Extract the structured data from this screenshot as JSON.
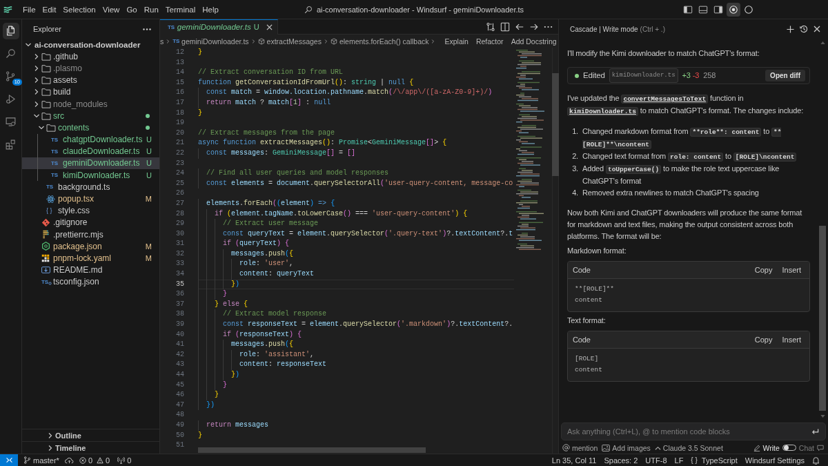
{
  "title_bar": {
    "menu": [
      "File",
      "Edit",
      "Selection",
      "View",
      "Go",
      "Run",
      "Terminal",
      "Help"
    ],
    "title": "ai-conversation-downloader - Windsurf - geminiDownloader.ts",
    "toggles": [
      {
        "kind": "sidebar",
        "selected": false
      },
      {
        "kind": "panel",
        "selected": false
      },
      {
        "kind": "auxiliary",
        "selected": false
      },
      {
        "kind": "cascade",
        "selected": true
      },
      {
        "kind": "account",
        "selected": false
      }
    ]
  },
  "activity_bar": [
    {
      "kind": "explorer",
      "selected": true
    },
    {
      "kind": "search",
      "selected": false
    },
    {
      "kind": "scm",
      "selected": false,
      "badge": "10"
    },
    {
      "kind": "debug",
      "selected": false
    },
    {
      "kind": "remote",
      "selected": false
    },
    {
      "kind": "extensions",
      "selected": false
    }
  ],
  "sidebar": {
    "title": "Explorer",
    "tree": [
      {
        "kind": "root",
        "label": "ai-conversation-downloader",
        "expanded": true,
        "selected": false,
        "children": [
          {
            "kind": "folder",
            "label": ".github",
            "expanded": false,
            "selected": false,
            "dot": false
          },
          {
            "kind": "folder",
            "label": ".plasmo",
            "expanded": false,
            "selected": false,
            "dot": false,
            "color": "#8c8c8c"
          },
          {
            "kind": "folder",
            "label": "assets",
            "expanded": false,
            "selected": false,
            "dot": false
          },
          {
            "kind": "folder",
            "label": "build",
            "expanded": false,
            "selected": false,
            "dot": false
          },
          {
            "kind": "folder",
            "label": "node_modules",
            "expanded": false,
            "selected": false,
            "dot": false,
            "color": "#8c8c8c"
          },
          {
            "kind": "folder",
            "label": "src",
            "expanded": true,
            "selected": false,
            "dot": true,
            "color": "#73c991",
            "children": [
              {
                "kind": "folder",
                "label": "contents",
                "expanded": true,
                "selected": false,
                "dot": true,
                "color": "#73c991",
                "children": [
                  {
                    "kind": "ts",
                    "icon_label": "TS",
                    "label": "chatgptDownloader.ts",
                    "selected": false,
                    "color": "#73c991",
                    "badge": "U"
                  },
                  {
                    "kind": "ts",
                    "icon_label": "TS",
                    "label": "claudeDownloader.ts",
                    "selected": false,
                    "color": "#73c991",
                    "badge": "U"
                  },
                  {
                    "kind": "ts",
                    "icon_label": "TS",
                    "label": "geminiDownloader.ts",
                    "selected": true,
                    "color": "#73c991",
                    "badge": "U"
                  },
                  {
                    "kind": "ts",
                    "icon_label": "TS",
                    "label": "kimiDownloader.ts",
                    "selected": false,
                    "color": "#73c991",
                    "badge": "U"
                  }
                ]
              },
              {
                "kind": "ts",
                "icon_label": "TS",
                "label": "background.ts",
                "selected": false
              },
              {
                "kind": "react",
                "label": "popup.tsx",
                "selected": false,
                "color": "#e2c08d",
                "badge": "M"
              },
              {
                "kind": "css",
                "icon_label": "{ }",
                "label": "style.css",
                "selected": false
              }
            ]
          },
          {
            "kind": "git",
            "label": ".gitignore",
            "selected": false
          },
          {
            "kind": "prettier",
            "label": ".prettierrc.mjs",
            "selected": false
          },
          {
            "kind": "npm",
            "label": "package.json",
            "selected": false,
            "color": "#e2c08d",
            "badge": "M"
          },
          {
            "kind": "pnpm",
            "label": "pnpm-lock.yaml",
            "selected": false,
            "color": "#e2c08d",
            "badge": "M"
          },
          {
            "kind": "markdown",
            "label": "README.md",
            "selected": false
          },
          {
            "kind": "tsconfig",
            "icon_label": "TS",
            "label": "tsconfig.json",
            "selected": false
          }
        ]
      }
    ],
    "sections": [
      {
        "label": "Outline",
        "expanded": false
      },
      {
        "label": "Timeline",
        "expanded": false
      }
    ]
  },
  "editor": {
    "tabs": [
      {
        "icon_label": "TS",
        "name": "geminiDownloader.ts",
        "badge": "U",
        "color": "#73c991",
        "preview": true,
        "selected": true
      }
    ],
    "breadcrumbs": [
      {
        "kind": "text",
        "label": "s"
      },
      {
        "kind": "file",
        "icon_label": "TS",
        "label": "geminiDownloader.ts"
      },
      {
        "kind": "symbol",
        "label": "extractMessages"
      },
      {
        "kind": "symbol",
        "label": "elements.forEach() callback"
      }
    ],
    "actions": [
      "Explain",
      "Refactor",
      "Add Docstring"
    ],
    "lines": [
      {
        "number": "12",
        "current": false,
        "tokens": [
          {
            "kind": "bracket1",
            "text": "}"
          }
        ]
      },
      {
        "number": "13",
        "current": false
      },
      {
        "number": "14",
        "current": false,
        "tokens": [
          {
            "kind": "comment",
            "text": "// Extract conversation ID from URL"
          }
        ]
      },
      {
        "number": "15",
        "current": false,
        "tokens": [
          {
            "kind": "keyword",
            "text": "function "
          },
          {
            "kind": "function",
            "text": "getConversationIdFromUrl"
          },
          {
            "kind": "bracket1",
            "text": "()"
          },
          {
            "kind": "plain",
            "text": ": "
          },
          {
            "kind": "type",
            "text": "string"
          },
          {
            "kind": "plain",
            "text": " | "
          },
          {
            "kind": "keyword",
            "text": "null "
          },
          {
            "kind": "bracket1",
            "text": "{"
          }
        ]
      },
      {
        "number": "16",
        "current": false,
        "tokens": [
          {
            "kind": "keyword",
            "text": "  const "
          },
          {
            "kind": "variable",
            "text": "match"
          },
          {
            "kind": "plain",
            "text": " = "
          },
          {
            "kind": "variable",
            "text": "window.location.pathname"
          },
          {
            "kind": "plain",
            "text": "."
          },
          {
            "kind": "function",
            "text": "match"
          },
          {
            "kind": "bracket2",
            "text": "("
          },
          {
            "kind": "regex",
            "text": "/\\/app\\/([a-zA-Z0-9]+)/"
          },
          {
            "kind": "bracket2",
            "text": ")"
          }
        ]
      },
      {
        "number": "17",
        "current": false,
        "tokens": [
          {
            "kind": "control",
            "text": "  return "
          },
          {
            "kind": "variable",
            "text": "match"
          },
          {
            "kind": "plain",
            "text": " ? "
          },
          {
            "kind": "variable",
            "text": "match"
          },
          {
            "kind": "bracket2",
            "text": "["
          },
          {
            "kind": "number",
            "text": "1"
          },
          {
            "kind": "bracket2",
            "text": "]"
          },
          {
            "kind": "plain",
            "text": " : "
          },
          {
            "kind": "keyword",
            "text": "null"
          }
        ]
      },
      {
        "number": "18",
        "current": false,
        "tokens": [
          {
            "kind": "bracket1",
            "text": "}"
          }
        ]
      },
      {
        "number": "19",
        "current": false
      },
      {
        "number": "20",
        "current": false,
        "tokens": [
          {
            "kind": "comment",
            "text": "// Extract messages from the page"
          }
        ]
      },
      {
        "number": "21",
        "current": false,
        "tokens": [
          {
            "kind": "keyword",
            "text": "async function "
          },
          {
            "kind": "function",
            "text": "extractMessages"
          },
          {
            "kind": "bracket1",
            "text": "()"
          },
          {
            "kind": "plain",
            "text": ": "
          },
          {
            "kind": "type",
            "text": "Promise"
          },
          {
            "kind": "plain",
            "text": "<"
          },
          {
            "kind": "type",
            "text": "GeminiMessage"
          },
          {
            "kind": "bracket2",
            "text": "[]"
          },
          {
            "kind": "plain",
            "text": "> "
          },
          {
            "kind": "bracket1",
            "text": "{"
          }
        ]
      },
      {
        "number": "22",
        "current": false,
        "tokens": [
          {
            "kind": "keyword",
            "text": "  const "
          },
          {
            "kind": "variable",
            "text": "messages"
          },
          {
            "kind": "plain",
            "text": ": "
          },
          {
            "kind": "type",
            "text": "GeminiMessage"
          },
          {
            "kind": "bracket2",
            "text": "[]"
          },
          {
            "kind": "plain",
            "text": " = "
          },
          {
            "kind": "bracket2",
            "text": "[]"
          }
        ]
      },
      {
        "number": "23",
        "current": false
      },
      {
        "number": "24",
        "current": false,
        "tokens": [
          {
            "kind": "comment",
            "text": "  // Find all user queries and model responses"
          }
        ]
      },
      {
        "number": "25",
        "current": false,
        "tokens": [
          {
            "kind": "keyword",
            "text": "  const "
          },
          {
            "kind": "variable",
            "text": "elements"
          },
          {
            "kind": "plain",
            "text": " = "
          },
          {
            "kind": "variable",
            "text": "document"
          },
          {
            "kind": "plain",
            "text": "."
          },
          {
            "kind": "function",
            "text": "querySelectorAll"
          },
          {
            "kind": "bracket2",
            "text": "("
          },
          {
            "kind": "string",
            "text": "'user-query-content, message-co"
          }
        ]
      },
      {
        "number": "26",
        "current": false
      },
      {
        "number": "27",
        "current": false,
        "tokens": [
          {
            "kind": "variable",
            "text": "  elements"
          },
          {
            "kind": "plain",
            "text": "."
          },
          {
            "kind": "function",
            "text": "forEach"
          },
          {
            "kind": "bracket2",
            "text": "("
          },
          {
            "kind": "bracket3",
            "text": "("
          },
          {
            "kind": "variable",
            "text": "element"
          },
          {
            "kind": "bracket3",
            "text": ")"
          },
          {
            "kind": "keyword",
            "text": " => "
          },
          {
            "kind": "bracket3",
            "text": "{"
          }
        ]
      },
      {
        "number": "28",
        "current": false,
        "tokens": [
          {
            "kind": "control",
            "text": "    if "
          },
          {
            "kind": "bracket1",
            "text": "("
          },
          {
            "kind": "variable",
            "text": "element.tagName"
          },
          {
            "kind": "plain",
            "text": "."
          },
          {
            "kind": "function",
            "text": "toLowerCase"
          },
          {
            "kind": "bracket2",
            "text": "()"
          },
          {
            "kind": "plain",
            "text": " === "
          },
          {
            "kind": "string",
            "text": "'user-query-content'"
          },
          {
            "kind": "bracket1",
            "text": ") {"
          }
        ]
      },
      {
        "number": "29",
        "current": false,
        "tokens": [
          {
            "kind": "comment",
            "text": "      // Extract user message"
          }
        ]
      },
      {
        "number": "30",
        "current": false,
        "tokens": [
          {
            "kind": "keyword",
            "text": "      const "
          },
          {
            "kind": "variable",
            "text": "queryText"
          },
          {
            "kind": "plain",
            "text": " = "
          },
          {
            "kind": "variable",
            "text": "element"
          },
          {
            "kind": "plain",
            "text": "."
          },
          {
            "kind": "function",
            "text": "querySelector"
          },
          {
            "kind": "bracket2",
            "text": "("
          },
          {
            "kind": "string",
            "text": "'.query-text'"
          },
          {
            "kind": "bracket2",
            "text": ")"
          },
          {
            "kind": "plain",
            "text": "?."
          },
          {
            "kind": "variable",
            "text": "textContent"
          },
          {
            "kind": "plain",
            "text": "?."
          },
          {
            "kind": "variable",
            "text": "t"
          }
        ]
      },
      {
        "number": "31",
        "current": false,
        "tokens": [
          {
            "kind": "control",
            "text": "      if "
          },
          {
            "kind": "bracket2",
            "text": "("
          },
          {
            "kind": "variable",
            "text": "queryText"
          },
          {
            "kind": "bracket2",
            "text": ") {"
          }
        ]
      },
      {
        "number": "32",
        "current": false,
        "tokens": [
          {
            "kind": "variable",
            "text": "        messages"
          },
          {
            "kind": "plain",
            "text": "."
          },
          {
            "kind": "function",
            "text": "push"
          },
          {
            "kind": "bracket3",
            "text": "("
          },
          {
            "kind": "bracket1",
            "text": "{"
          }
        ]
      },
      {
        "number": "33",
        "current": false,
        "tokens": [
          {
            "kind": "variable",
            "text": "          role"
          },
          {
            "kind": "plain",
            "text": ": "
          },
          {
            "kind": "string",
            "text": "'user'"
          },
          {
            "kind": "plain",
            "text": ","
          }
        ]
      },
      {
        "number": "34",
        "current": false,
        "tokens": [
          {
            "kind": "variable",
            "text": "          content"
          },
          {
            "kind": "plain",
            "text": ": "
          },
          {
            "kind": "variable",
            "text": "queryText"
          }
        ]
      },
      {
        "number": "35",
        "current": true,
        "tokens": [
          {
            "kind": "bracket1",
            "text": "        }"
          },
          {
            "kind": "bracket3",
            "text": ")"
          }
        ]
      },
      {
        "number": "36",
        "current": false,
        "tokens": [
          {
            "kind": "bracket2",
            "text": "      }"
          }
        ]
      },
      {
        "number": "37",
        "current": false,
        "tokens": [
          {
            "kind": "bracket1",
            "text": "    }"
          },
          {
            "kind": "control",
            "text": " else "
          },
          {
            "kind": "bracket1",
            "text": "{"
          }
        ]
      },
      {
        "number": "38",
        "current": false,
        "tokens": [
          {
            "kind": "comment",
            "text": "      // Extract model response"
          }
        ]
      },
      {
        "number": "39",
        "current": false,
        "tokens": [
          {
            "kind": "keyword",
            "text": "      const "
          },
          {
            "kind": "variable",
            "text": "responseText"
          },
          {
            "kind": "plain",
            "text": " = "
          },
          {
            "kind": "variable",
            "text": "element"
          },
          {
            "kind": "plain",
            "text": "."
          },
          {
            "kind": "function",
            "text": "querySelector"
          },
          {
            "kind": "bracket2",
            "text": "("
          },
          {
            "kind": "string",
            "text": "'.markdown'"
          },
          {
            "kind": "bracket2",
            "text": ")"
          },
          {
            "kind": "plain",
            "text": "?."
          },
          {
            "kind": "variable",
            "text": "textContent"
          },
          {
            "kind": "plain",
            "text": "?."
          }
        ]
      },
      {
        "number": "40",
        "current": false,
        "tokens": [
          {
            "kind": "control",
            "text": "      if "
          },
          {
            "kind": "bracket2",
            "text": "("
          },
          {
            "kind": "variable",
            "text": "responseText"
          },
          {
            "kind": "bracket2",
            "text": ") {"
          }
        ]
      },
      {
        "number": "41",
        "current": false,
        "tokens": [
          {
            "kind": "variable",
            "text": "        messages"
          },
          {
            "kind": "plain",
            "text": "."
          },
          {
            "kind": "function",
            "text": "push"
          },
          {
            "kind": "bracket3",
            "text": "("
          },
          {
            "kind": "bracket1",
            "text": "{"
          }
        ]
      },
      {
        "number": "42",
        "current": false,
        "tokens": [
          {
            "kind": "variable",
            "text": "          role"
          },
          {
            "kind": "plain",
            "text": ": "
          },
          {
            "kind": "string",
            "text": "'assistant'"
          },
          {
            "kind": "plain",
            "text": ","
          }
        ]
      },
      {
        "number": "43",
        "current": false,
        "tokens": [
          {
            "kind": "variable",
            "text": "          content"
          },
          {
            "kind": "plain",
            "text": ": "
          },
          {
            "kind": "variable",
            "text": "responseText"
          }
        ]
      },
      {
        "number": "44",
        "current": false,
        "tokens": [
          {
            "kind": "bracket1",
            "text": "        }"
          },
          {
            "kind": "bracket3",
            "text": ")"
          }
        ]
      },
      {
        "number": "45",
        "current": false,
        "tokens": [
          {
            "kind": "bracket2",
            "text": "      }"
          }
        ]
      },
      {
        "number": "46",
        "current": false,
        "tokens": [
          {
            "kind": "bracket1",
            "text": "    }"
          }
        ]
      },
      {
        "number": "47",
        "current": false,
        "tokens": [
          {
            "kind": "bracket3",
            "text": "  })"
          }
        ]
      },
      {
        "number": "48",
        "current": false
      },
      {
        "number": "49",
        "current": false,
        "tokens": [
          {
            "kind": "control",
            "text": "  return "
          },
          {
            "kind": "variable",
            "text": "messages"
          }
        ]
      },
      {
        "number": "50",
        "current": false,
        "tokens": [
          {
            "kind": "bracket1",
            "text": "}"
          }
        ]
      },
      {
        "number": "51",
        "current": false
      }
    ]
  },
  "cascade": {
    "title": "Cascade | Write mode",
    "shortcut": "(Ctrl + .)",
    "blocks": [
      {
        "kind": "paragraph",
        "parts": [
          {
            "kind": "text",
            "text": "I'll modify the Kimi downloader to match ChatGPT's format:"
          }
        ]
      },
      {
        "kind": "edit",
        "color": "#89d185",
        "label": "Edited",
        "file": "kimiDownloader.ts",
        "added": "+3",
        "removed": "-3",
        "count": "258",
        "button": "Open diff"
      },
      {
        "kind": "paragraph",
        "parts": [
          {
            "kind": "text",
            "text": "I've updated the "
          },
          {
            "kind": "link",
            "text": "convertMessagesToText"
          },
          {
            "kind": "text",
            "text": " function in "
          },
          {
            "kind": "link",
            "text": "kimiDownloader.ts"
          },
          {
            "kind": "text",
            "text": " to match ChatGPT's format. The changes include:"
          }
        ]
      },
      {
        "kind": "list",
        "items": [
          {
            "number": "1.",
            "parts": [
              {
                "kind": "text",
                "text": "Changed markdown format from "
              },
              {
                "kind": "code",
                "text": "**role**: content"
              },
              {
                "kind": "text",
                "text": " to "
              },
              {
                "kind": "code",
                "text": "**[ROLE]**\\ncontent"
              }
            ]
          },
          {
            "number": "2.",
            "parts": [
              {
                "kind": "text",
                "text": "Changed text format from "
              },
              {
                "kind": "code",
                "text": "role: content"
              },
              {
                "kind": "text",
                "text": " to "
              },
              {
                "kind": "code",
                "text": "[ROLE]\\ncontent"
              }
            ]
          },
          {
            "number": "3.",
            "parts": [
              {
                "kind": "text",
                "text": "Added "
              },
              {
                "kind": "code",
                "text": "toUpperCase()"
              },
              {
                "kind": "text",
                "text": " to make the role text uppercase like ChatGPT's format"
              }
            ]
          },
          {
            "number": "4.",
            "parts": [
              {
                "kind": "text",
                "text": "Removed extra newlines to match ChatGPT's spacing"
              }
            ]
          }
        ]
      },
      {
        "kind": "paragraph",
        "parts": [
          {
            "kind": "text",
            "text": "Now both Kimi and ChatGPT downloaders will produce the same format for markdown and text files, making the output consistent across both platforms. The format will be:"
          }
        ]
      },
      {
        "kind": "paragraph",
        "parts": [
          {
            "kind": "text",
            "text": "Markdown format:"
          }
        ]
      },
      {
        "kind": "code",
        "title": "Code",
        "buttons": [
          "Copy",
          "Insert"
        ],
        "lines": [
          "**[ROLE]**",
          "content"
        ]
      },
      {
        "kind": "paragraph",
        "parts": [
          {
            "kind": "text",
            "text": "Text format:"
          }
        ]
      },
      {
        "kind": "code",
        "title": "Code",
        "buttons": [
          "Copy",
          "Insert"
        ],
        "lines": [
          "[ROLE]",
          "content"
        ]
      }
    ],
    "input": {
      "placeholder": "Ask anything (Ctrl+L), @ to mention code blocks"
    },
    "footer": {
      "mention": "mention",
      "add_images": "Add images",
      "model": "Claude 3.5 Sonnet",
      "modes": [
        {
          "label": "Write",
          "selected": true
        },
        {
          "label": "Chat",
          "selected": false
        }
      ]
    }
  },
  "status_bar": {
    "branch": "master*",
    "errors": "0",
    "warnings": "0",
    "ports": "0",
    "right": [
      {
        "kind": "text",
        "label": "Ln 35, Col 11"
      },
      {
        "kind": "text",
        "label": "Spaces: 2"
      },
      {
        "kind": "text",
        "label": "UTF-8"
      },
      {
        "kind": "text",
        "label": "LF"
      },
      {
        "kind": "language",
        "icon_label": "{ }",
        "label": "TypeScript"
      },
      {
        "kind": "text",
        "label": "Windsurf Settings"
      }
    ]
  }
}
